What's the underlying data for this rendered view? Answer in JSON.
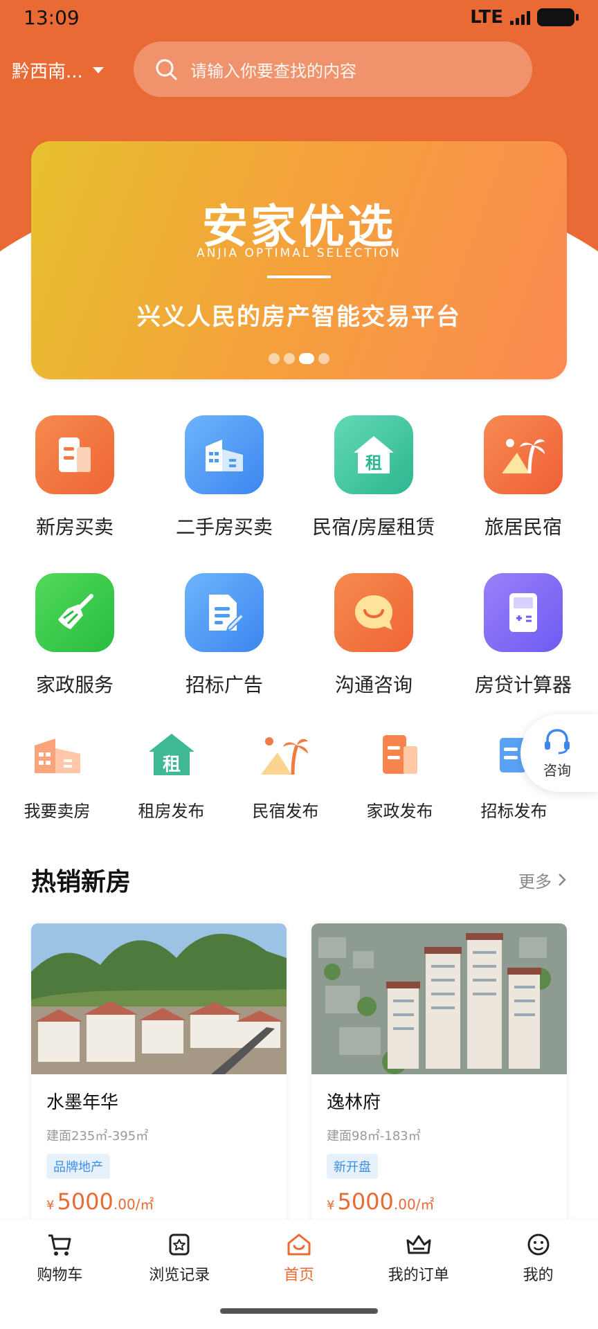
{
  "status": {
    "time": "13:09",
    "network": "LTE"
  },
  "header": {
    "location": "黔西南...",
    "search_placeholder": "请输入你要查找的内容"
  },
  "banner": {
    "title": "安家优选",
    "subtitle": "ANJIA OPTIMAL SELECTION",
    "slogan": "兴义人民的房产智能交易平台",
    "active_dot": 2,
    "dot_count": 4
  },
  "services": [
    {
      "label": "新房买卖",
      "icon": "building-doc-icon",
      "color": "#f27a44"
    },
    {
      "label": "二手房买卖",
      "icon": "apartment-icon",
      "color": "#4f9af3"
    },
    {
      "label": "民宿/房屋租赁",
      "icon": "rent-house-icon",
      "color": "#3bc3a0"
    },
    {
      "label": "旅居民宿",
      "icon": "palm-tree-icon",
      "color": "#f2673e"
    },
    {
      "label": "家政服务",
      "icon": "broom-icon",
      "color": "#3dcc52"
    },
    {
      "label": "招标广告",
      "icon": "document-edit-icon",
      "color": "#4f9af3"
    },
    {
      "label": "沟通咨询",
      "icon": "chat-smile-icon",
      "color": "#f27a44"
    },
    {
      "label": "房贷计算器",
      "icon": "calculator-icon",
      "color": "#7f6cf5"
    }
  ],
  "quick_actions": [
    {
      "label": "我要卖房",
      "icon": "sell-house-icon"
    },
    {
      "label": "租房发布",
      "icon": "rent-publish-icon"
    },
    {
      "label": "民宿发布",
      "icon": "homestay-publish-icon"
    },
    {
      "label": "家政发布",
      "icon": "housekeeping-publish-icon"
    },
    {
      "label": "招标发布",
      "icon": "tender-publish-icon"
    }
  ],
  "consult": {
    "label": "咨询"
  },
  "hot_section": {
    "title": "热销新房",
    "more": "更多"
  },
  "listings": [
    {
      "name": "水墨年华",
      "area": "建面235㎡-395㎡",
      "tag": "品牌地产",
      "currency": "¥",
      "price": "5000",
      "unit": ".00/㎡"
    },
    {
      "name": "逸林府",
      "area": "建面98㎡-183㎡",
      "tag": "新开盘",
      "currency": "¥",
      "price": "5000",
      "unit": ".00/㎡"
    }
  ],
  "tabbar": [
    {
      "label": "购物车",
      "icon": "cart-icon"
    },
    {
      "label": "浏览记录",
      "icon": "history-icon"
    },
    {
      "label": "首页",
      "icon": "home-icon",
      "active": true
    },
    {
      "label": "我的订单",
      "icon": "orders-icon"
    },
    {
      "label": "我的",
      "icon": "profile-icon"
    }
  ]
}
